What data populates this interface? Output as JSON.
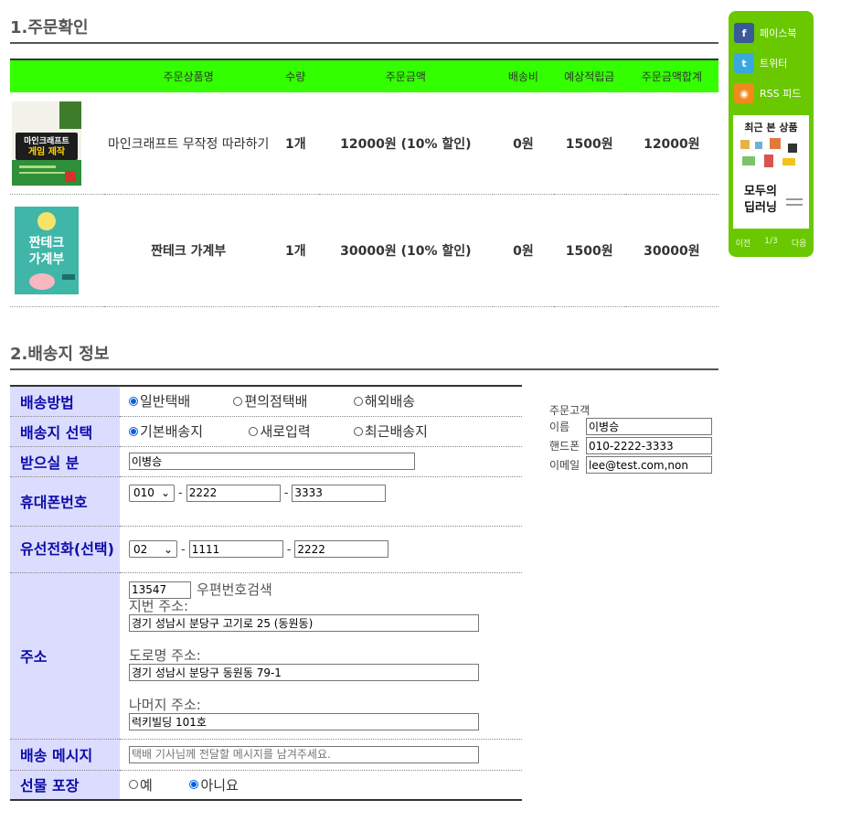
{
  "section1": {
    "title": "1.주문확인"
  },
  "order": {
    "headers": [
      "주문상품명",
      "수량",
      "주문금액",
      "배송비",
      "예상적립금",
      "주문금액합계"
    ],
    "rows": [
      {
        "cover_text": [
          "마인크래프트",
          "게임 제작"
        ],
        "name": "마인크래프트 무작정 따라하기",
        "qty": "1개",
        "price": "12000원 (10% 할인)",
        "shipping": "0원",
        "points": "1500원",
        "total": "12000원"
      },
      {
        "cover_text": [
          "짠테크",
          "가계부"
        ],
        "name": "짠테크 가계부",
        "qty": "1개",
        "price": "30000원 (10% 할인)",
        "shipping": "0원",
        "points": "1500원",
        "total": "30000원"
      }
    ]
  },
  "sidebar": {
    "facebook": "페이스북",
    "twitter": "트위터",
    "rss": "RSS 피드",
    "recent_title": "최근 본 상품",
    "recent_cover": [
      "모두의",
      "딥러닝"
    ],
    "prev": "이전",
    "page": "1/3",
    "next": "다음"
  },
  "section2": {
    "title": "2.배송지 정보"
  },
  "delivery": {
    "method_label": "배송방법",
    "method_options": [
      "일반택배",
      "편의점택배",
      "해외배송"
    ],
    "address_select_label": "배송지 선택",
    "address_select_options": [
      "기본배송지",
      "새로입력",
      "최근배송지"
    ],
    "recipient_label": "받으실 분",
    "recipient_value": "이병승",
    "mobile_label": "휴대폰번호",
    "mobile_prefix": "010",
    "mobile_mid": "2222",
    "mobile_last": "3333",
    "phone_label": "유선전화(선택)",
    "phone_prefix": "02",
    "phone_mid": "1111",
    "phone_last": "2222",
    "address_label": "주소",
    "zipcode": "13547",
    "zip_search": "우편번호검색",
    "jibun_label": "지번 주소:",
    "jibun_value": "경기 성남시 분당구 고기로 25 (동원동)",
    "road_label": "도로명 주소:",
    "road_value": "경기 성남시 분당구 동원동 79-1",
    "rest_label": "나머지 주소:",
    "rest_value": "럭키빌딩 101호",
    "message_label": "배송 메시지",
    "message_placeholder": "택배 기사님께 전달할 메시지를 남겨주세요.",
    "gift_label": "선물 포장",
    "gift_options": [
      "예",
      "아니요"
    ],
    "dash": "-"
  },
  "customer": {
    "title": "주문고객",
    "name_label": "이름",
    "name_value": "이병승",
    "phone_label": "핸드폰",
    "phone_value": "010-2222-3333",
    "email_label": "이메일",
    "email_value": "lee@test.com,non"
  },
  "colors": {
    "header_green": "#33ff00",
    "sidebar_green": "#6ac800",
    "label_bg": "#dcdcff",
    "label_text": "#0b0ba8"
  },
  "icons": [
    "facebook-icon",
    "twitter-icon",
    "rss-icon"
  ]
}
